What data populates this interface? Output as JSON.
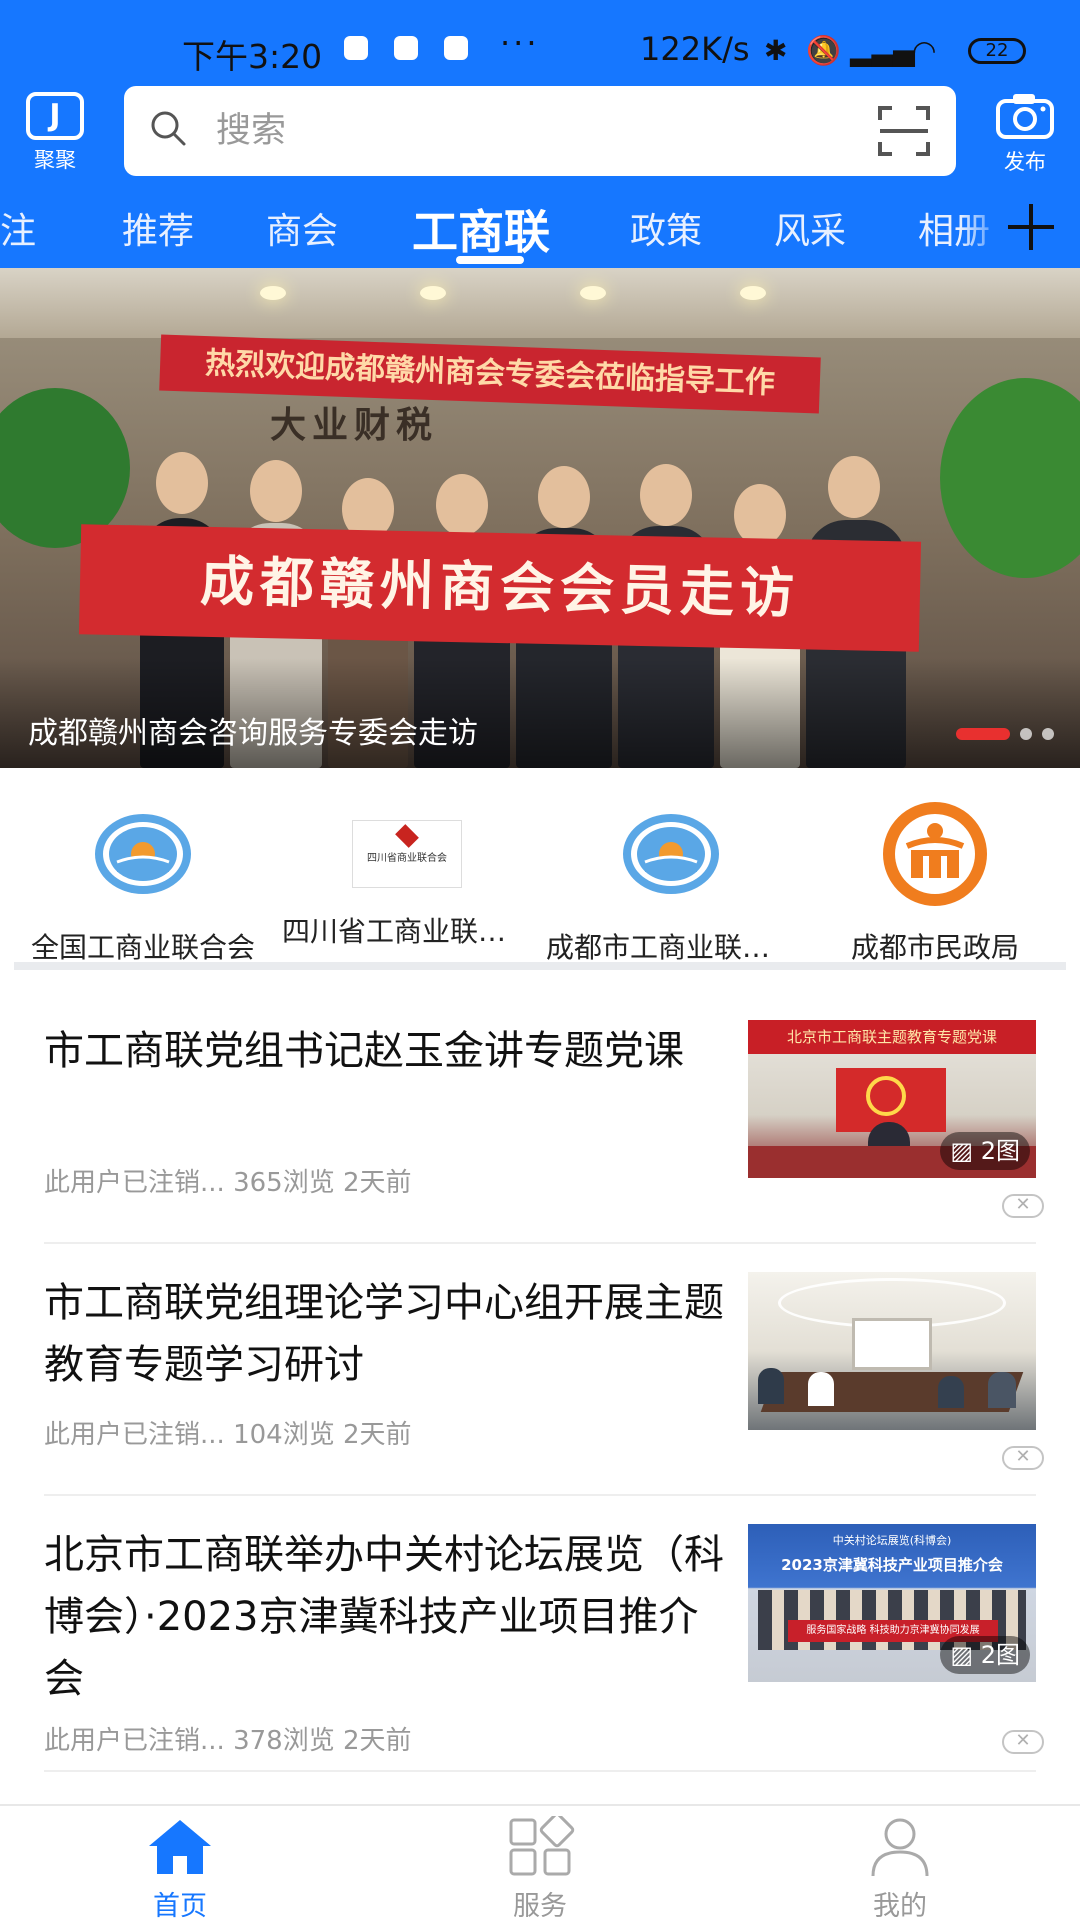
{
  "status_bar": {
    "time": "下午3:20",
    "more": "···",
    "network_speed": "122K/s",
    "battery": "22"
  },
  "header": {
    "logo_label": "聚聚",
    "search_placeholder": "搜索",
    "publish_label": "发布"
  },
  "tabs": [
    {
      "label": "关注",
      "active": false
    },
    {
      "label": "推荐",
      "active": false
    },
    {
      "label": "商会",
      "active": false
    },
    {
      "label": "工商联",
      "active": true
    },
    {
      "label": "政策",
      "active": false
    },
    {
      "label": "风采",
      "active": false
    },
    {
      "label": "相册",
      "active": false
    }
  ],
  "banner": {
    "sign_text": "热烈欢迎成都赣州商会专委会莅临指导工作",
    "wall_text": "大业财税",
    "banner_text": "成都赣州商会会员走访",
    "caption": "成都赣州商会咨询服务专委会走访",
    "slide_count": 3,
    "active_slide": 1
  },
  "shortcuts": [
    {
      "label": "全国工商业联合会",
      "icon": "acfic-logo-icon"
    },
    {
      "label": "四川省工商业联合会",
      "icon": "sichuan-chamber-logo-icon",
      "logo_text": "四川省商业联合会"
    },
    {
      "label": "成都市工商业联合会",
      "icon": "acfic-logo-icon"
    },
    {
      "label": "成都市民政局",
      "icon": "civil-affairs-logo-icon"
    }
  ],
  "news": [
    {
      "title": "市工商联党组书记赵玉金讲专题党课",
      "author": "此用户已注销...",
      "views": "365浏览",
      "time": "2天前",
      "badge": "2图",
      "thumb_banner": "北京市工商联主题教育专题党课"
    },
    {
      "title": "市工商联党组理论学习中心组开展主题教育专题学习研讨",
      "author": "此用户已注销...",
      "views": "104浏览",
      "time": "2天前",
      "badge": ""
    },
    {
      "title": "北京市工商联举办中关村论坛展览（科博会）·2023京津冀科技产业项目推介会",
      "author": "此用户已注销...",
      "views": "378浏览",
      "time": "2天前",
      "badge": "2图",
      "thumb_header": "中关村论坛展览(科博会)",
      "thumb_title": "2023京津冀科技产业项目推介会",
      "thumb_banner": "服务国家战略 科技助力京津冀协同发展"
    }
  ],
  "bottom_nav": [
    {
      "label": "首页",
      "active": true
    },
    {
      "label": "服务",
      "active": false
    },
    {
      "label": "我的",
      "active": false
    }
  ],
  "colors": {
    "brand": "#1677ff",
    "banner_red": "#d32b2f",
    "muted_text": "#999999"
  }
}
